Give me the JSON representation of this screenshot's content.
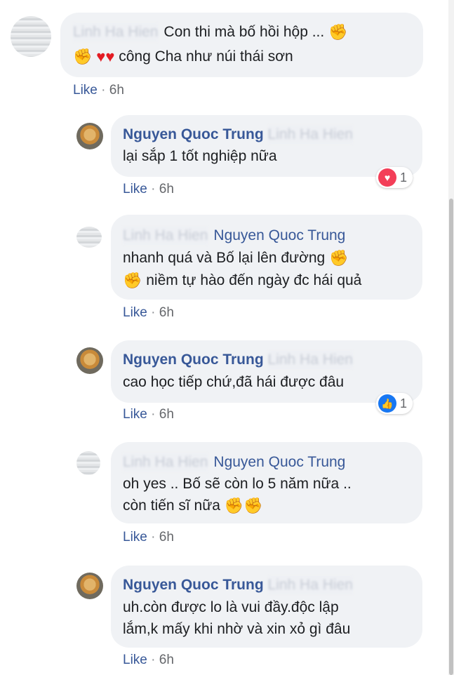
{
  "comments": [
    {
      "name": "Linh Ha Hien",
      "tag": "",
      "line1": "Con thi mà bố hồi hộp ...",
      "line2": "công Cha như núi thái sơn",
      "like": "Like",
      "time": "6h"
    },
    {
      "name": "Nguyen Quoc Trung",
      "tag": "Linh Ha Hien",
      "line1": "lại sắp 1 tốt nghiệp nữa",
      "like": "Like",
      "time": "6h",
      "reaction_count": "1"
    },
    {
      "name": "Linh Ha Hien",
      "tag": "Nguyen Quoc Trung",
      "line1": "nhanh quá và Bố lại lên đường",
      "line2": "niềm tự hào đến ngày đc hái quả",
      "like": "Like",
      "time": "6h"
    },
    {
      "name": "Nguyen Quoc Trung",
      "tag": "Linh Ha Hien",
      "line1": "cao học tiếp chứ,đã hái được đâu",
      "like": "Like",
      "time": "6h",
      "reaction_count": "1"
    },
    {
      "name": "Linh Ha Hien",
      "tag": "Nguyen Quoc Trung",
      "line1": "oh yes .. Bố sẽ còn lo 5 năm nữa ..",
      "line2": "còn tiến sĩ nữa",
      "like": "Like",
      "time": "6h"
    },
    {
      "name": "Nguyen Quoc Trung",
      "tag": "Linh Ha Hien",
      "line1": "uh.còn được lo là vui đầy.độc lập",
      "line2": "lắm,k mấy khi nhờ và xin xỏ gì đâu",
      "like": "Like",
      "time": "6h"
    }
  ],
  "separator": "·",
  "icons": {
    "strong": "flexed-biceps-emoji",
    "heart": "red-heart-emoji",
    "love_reaction": "heart-reaction-icon",
    "like_reaction": "thumbs-up-reaction-icon"
  },
  "colors": {
    "bubble": "#f0f2f5",
    "name": "#385898",
    "text": "#1c1e21",
    "meta": "#65676b",
    "love": "#f33e58",
    "like": "#1877f2"
  }
}
